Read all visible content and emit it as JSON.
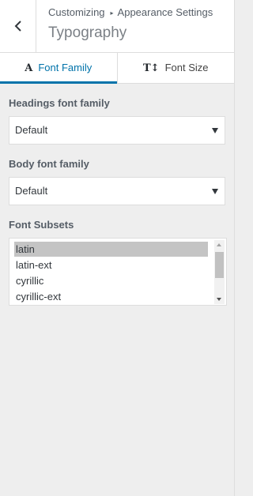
{
  "header": {
    "breadcrumb": [
      "Customizing",
      "Appearance Settings"
    ],
    "title": "Typography",
    "back_icon": "chevron-left-icon"
  },
  "tabs": [
    {
      "label": "Font Family",
      "icon": "font-family-icon",
      "icon_glyph": "A",
      "active": true
    },
    {
      "label": "Font Size",
      "icon": "font-size-icon",
      "icon_glyph": "T↕",
      "active": false
    }
  ],
  "controls": {
    "headings": {
      "label": "Headings font family",
      "value": "Default"
    },
    "body": {
      "label": "Body font family",
      "value": "Default"
    },
    "subsets": {
      "label": "Font Subsets",
      "options": [
        "latin",
        "latin-ext",
        "cyrillic",
        "cyrillic-ext"
      ],
      "selected": "latin"
    }
  },
  "colors": {
    "accent": "#0073aa",
    "panel_bg": "#eeeeee",
    "selected_option_bg": "#c4c4c4"
  }
}
